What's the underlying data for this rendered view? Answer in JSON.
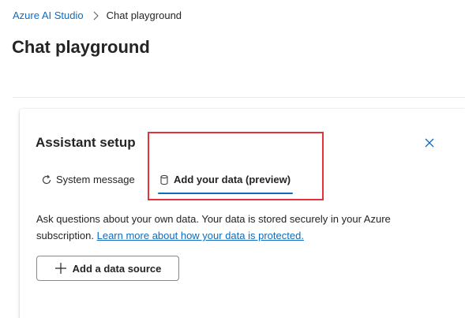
{
  "breadcrumb": {
    "root": "Azure AI Studio",
    "current": "Chat playground"
  },
  "page": {
    "title": "Chat playground"
  },
  "assistant_setup": {
    "title": "Assistant setup",
    "tabs": [
      {
        "label": "System message",
        "icon": "rotate-arrow-icon",
        "selected": false
      },
      {
        "label": "Add your data (preview)",
        "icon": "database-icon",
        "selected": true
      }
    ],
    "description": "Ask questions about your own data. Your data is stored securely in your Azure subscription.",
    "learn_more_link": "Learn more about how your data is protected.",
    "add_source_button": "Add a data source",
    "close_icon": "close-icon"
  },
  "colors": {
    "link": "#0f6cbd",
    "accent": "#0f6cbd",
    "highlight": "#e5323a",
    "text": "#242424"
  }
}
